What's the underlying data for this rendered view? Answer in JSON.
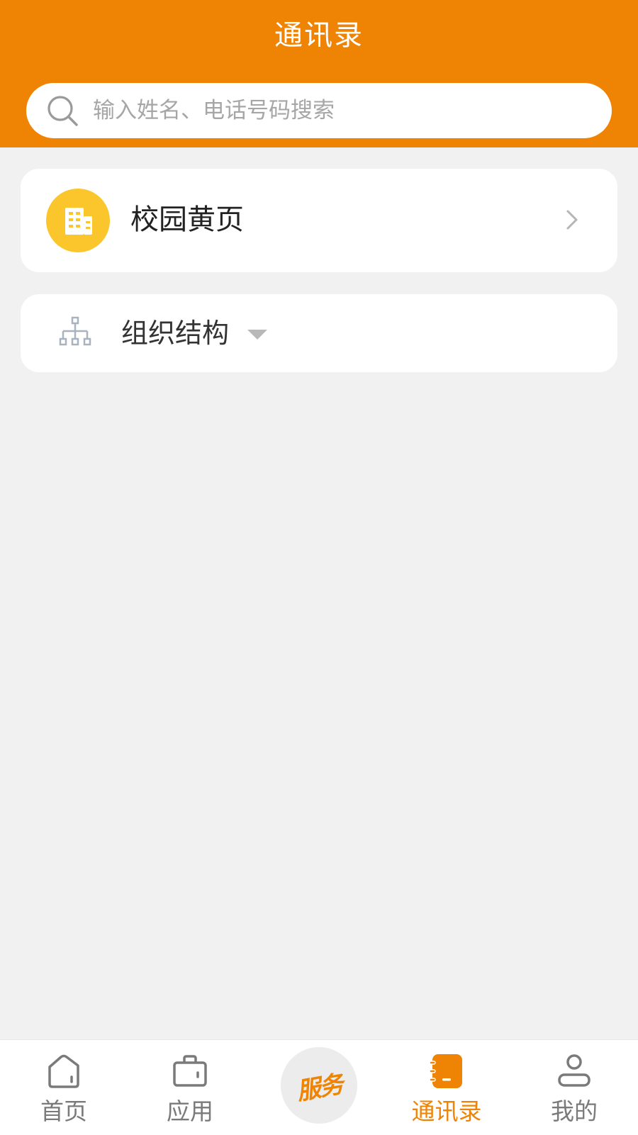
{
  "header": {
    "title": "通讯录"
  },
  "search": {
    "placeholder": "输入姓名、电话号码搜索",
    "value": ""
  },
  "yellow_pages": {
    "label": "校园黄页",
    "icon": "building-icon"
  },
  "org": {
    "label": "组织结构",
    "icon": "org-chart-icon"
  },
  "tabbar": {
    "tabs": [
      {
        "label": "首页",
        "icon": "home-icon",
        "active": false
      },
      {
        "label": "应用",
        "icon": "briefcase-icon",
        "active": false
      },
      {
        "label": "服务",
        "icon": "service-icon",
        "active": false
      },
      {
        "label": "通讯录",
        "icon": "contacts-book-icon",
        "active": true
      },
      {
        "label": "我的",
        "icon": "person-icon",
        "active": false
      }
    ]
  },
  "colors": {
    "accent": "#ef8304",
    "yellow_icon": "#fbc62c",
    "background": "#f1f1f1"
  }
}
